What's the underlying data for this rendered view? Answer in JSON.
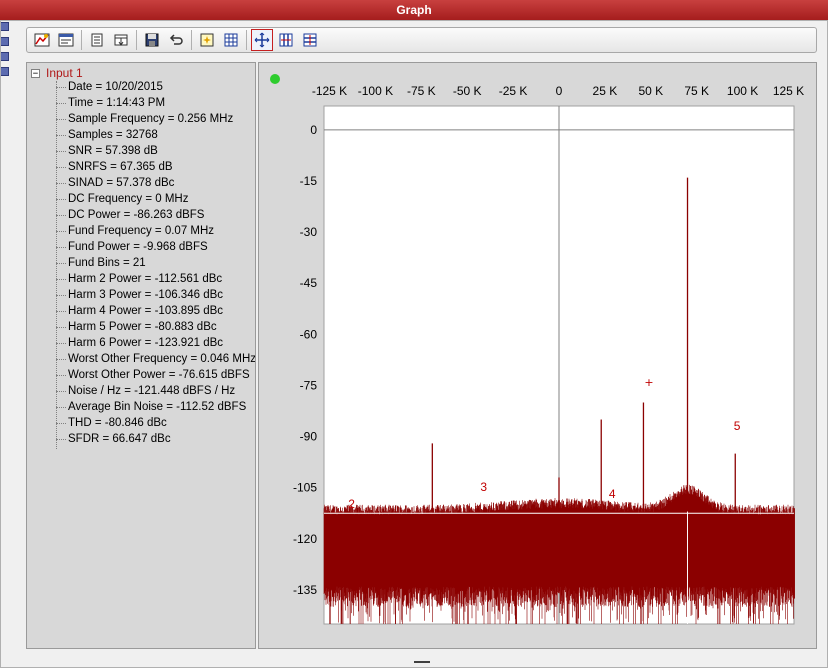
{
  "window": {
    "title": "Graph"
  },
  "toolbar": {
    "buttons": [
      {
        "icon": "chart-properties-icon"
      },
      {
        "icon": "window-icon"
      },
      {
        "icon": "list-icon"
      },
      {
        "icon": "export-table-icon"
      },
      {
        "icon": "save-icon"
      },
      {
        "icon": "undo-arrow-icon"
      },
      {
        "icon": "autoscale-icon"
      },
      {
        "icon": "grid-icon"
      },
      {
        "icon": "pan-move-icon",
        "active": true
      },
      {
        "icon": "zoom-x-icon"
      },
      {
        "icon": "zoom-y-icon"
      }
    ]
  },
  "tree": {
    "root_label": "Input 1",
    "expander": "−",
    "items": [
      "Date = 10/20/2015",
      "Time = 1:14:43 PM",
      "Sample Frequency = 0.256 MHz",
      "Samples = 32768",
      "SNR = 57.398 dB",
      "SNRFS = 67.365 dB",
      "SINAD = 57.378 dBc",
      "DC Frequency = 0 MHz",
      "DC Power = -86.263 dBFS",
      "Fund Frequency = 0.07 MHz",
      "Fund Power = -9.968 dBFS",
      "Fund Bins = 21",
      "Harm 2 Power = -112.561 dBc",
      "Harm 3 Power = -106.346 dBc",
      "Harm 4 Power = -103.895 dBc",
      "Harm 5 Power = -80.883 dBc",
      "Harm 6 Power = -123.921 dBc",
      "Worst Other Frequency = 0.046 MHz",
      "Worst Other Power = -76.615 dBFS",
      "Noise / Hz = -121.448 dBFS / Hz",
      "Average Bin Noise = -112.52 dBFS",
      "THD = -80.846 dBc",
      "SFDR = 66.647 dBc"
    ]
  },
  "colors": {
    "trace": "#8b0000",
    "harmonic_label": "#c00000",
    "status_led": "#2ecc2e"
  },
  "chart_data": {
    "type": "line",
    "xlim": [
      -128000,
      128000
    ],
    "ylim": [
      -145,
      7
    ],
    "x_ticks": [
      -125000,
      -100000,
      -75000,
      -50000,
      -25000,
      0,
      25000,
      50000,
      75000,
      100000,
      125000
    ],
    "x_tick_labels": [
      "-125 K",
      "-100 K",
      "-75 K",
      "-50 K",
      "-25 K",
      "0",
      "25 K",
      "50 K",
      "75 K",
      "100 K",
      "125 K"
    ],
    "y_ticks": [
      0,
      -15,
      -30,
      -45,
      -60,
      -75,
      -90,
      -105,
      -120,
      -135
    ],
    "y_tick_labels": [
      "0",
      "-15",
      "-30",
      "-45",
      "-60",
      "-75",
      "-90",
      "-105",
      "-120",
      "-135"
    ],
    "noise_floor": {
      "center": -126,
      "top": -112,
      "bottom": -140
    },
    "average_noise_line": -112.5,
    "spurs": [
      {
        "x": 70000,
        "y": -14
      },
      {
        "x": -69000,
        "y": -92
      },
      {
        "x": 23000,
        "y": -85
      },
      {
        "x": 46000,
        "y": -80
      },
      {
        "x": 96000,
        "y": -95
      },
      {
        "x": 0,
        "y": -102
      }
    ],
    "worst_other_marker": {
      "x": 49000,
      "y": -74,
      "label": "+"
    },
    "harmonic_labels": [
      {
        "label": "2",
        "x": -113000,
        "y": -111
      },
      {
        "label": "3",
        "x": -41000,
        "y": -106
      },
      {
        "label": "4",
        "x": 29000,
        "y": -108
      },
      {
        "label": "5",
        "x": 97000,
        "y": -88
      }
    ]
  }
}
